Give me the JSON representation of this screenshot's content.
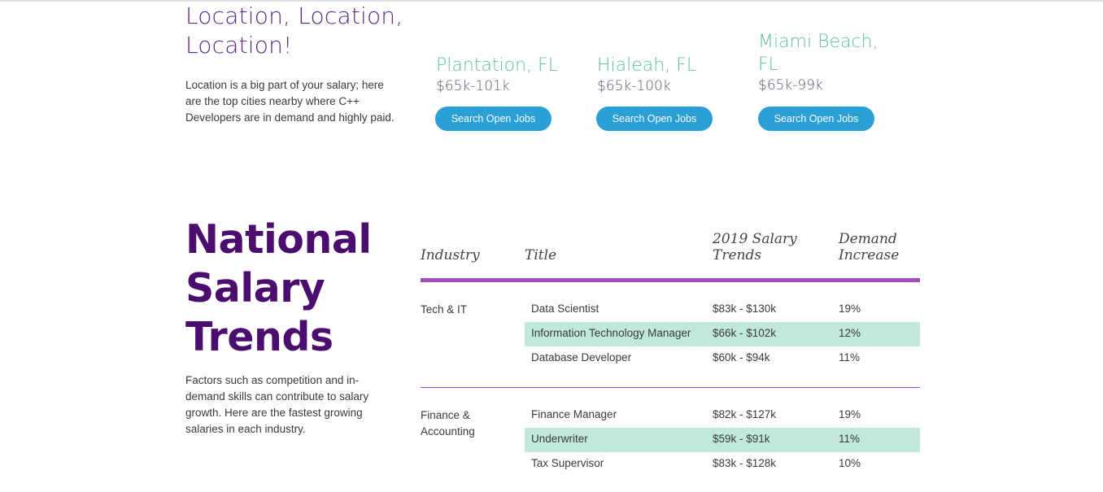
{
  "location_section": {
    "heading": "Location, Location, Location!",
    "description": "Location is a big part of your salary; here are the top cities nearby where C++ Developers are in demand and highly paid.",
    "cities": [
      {
        "name": "Plantation, FL",
        "range": "$65k-101k",
        "button": "Search Open Jobs"
      },
      {
        "name": "Hialeah, FL",
        "range": "$65k-100k",
        "button": "Search Open Jobs"
      },
      {
        "name": "Miami Beach, FL",
        "range": "$65k-99k",
        "button": "Search Open Jobs"
      }
    ]
  },
  "national_section": {
    "heading": "National Salary Trends",
    "description": "Factors such as competition and in-demand skills can contribute to salary growth. Here are the fastest growing salaries in each industry.",
    "table": {
      "headers": {
        "industry": "Industry",
        "title": "Title",
        "salary": "2019 Salary Trends",
        "demand": "Demand Increase"
      },
      "groups": [
        {
          "industry": "Tech & IT",
          "rows": [
            {
              "title": "Data Scientist",
              "salary": "$83k - $130k",
              "demand": "19%",
              "highlight": false
            },
            {
              "title": "Information Technology Manager",
              "salary": "$66k - $102k",
              "demand": "12%",
              "highlight": true
            },
            {
              "title": "Database Developer",
              "salary": "$60k - $94k",
              "demand": "11%",
              "highlight": false
            }
          ]
        },
        {
          "industry": "Finance & Accounting",
          "rows": [
            {
              "title": "Finance Manager",
              "salary": "$82k - $127k",
              "demand": "19%",
              "highlight": false
            },
            {
              "title": "Underwriter",
              "salary": "$59k - $91k",
              "demand": "11%",
              "highlight": true
            },
            {
              "title": "Tax Supervisor",
              "salary": "$83k - $128k",
              "demand": "10%",
              "highlight": false
            }
          ]
        }
      ]
    }
  },
  "colors": {
    "heading_purple": "#5b2a86",
    "dark_purple": "#4b0d6e",
    "city_green": "#5cc29a",
    "button_blue": "#2a9fd8",
    "rule_purple": "#a04cc0",
    "row_highlight": "#c1e8dc"
  }
}
